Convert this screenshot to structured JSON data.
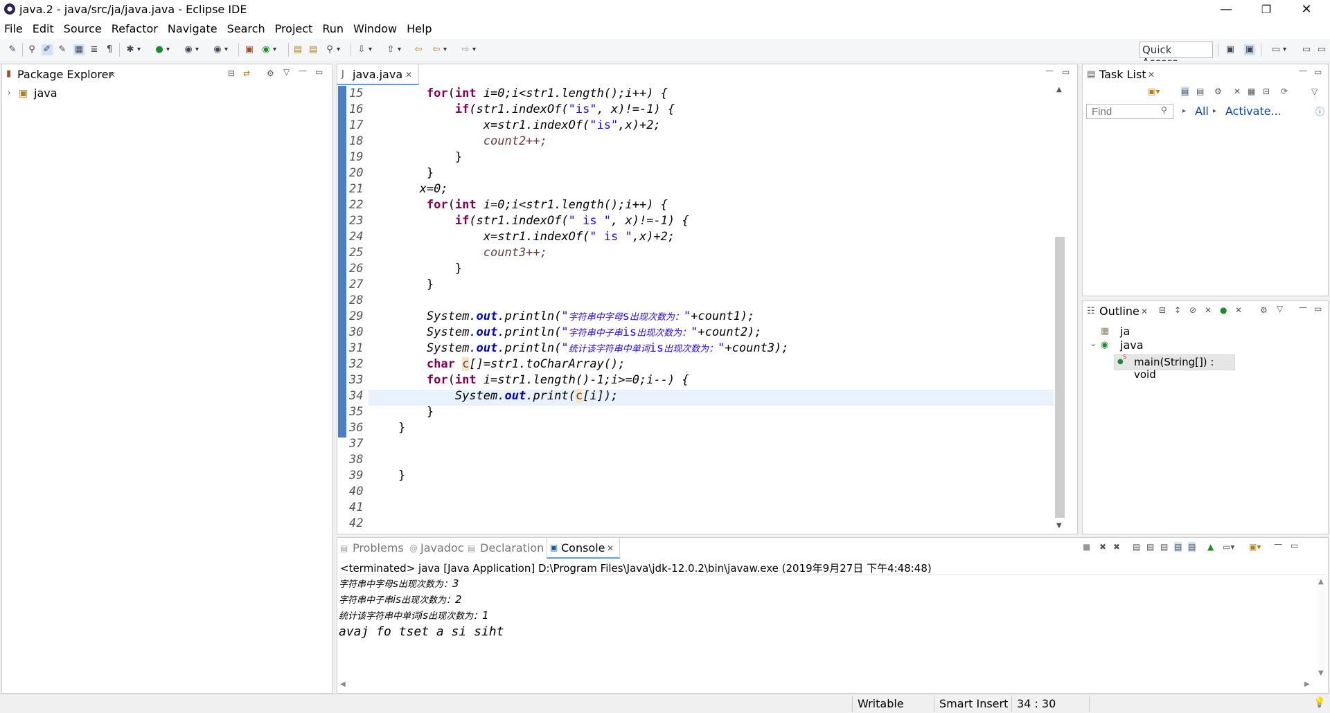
{
  "window": {
    "title": "java.2 - java/src/ja/java.java - Eclipse IDE",
    "minimize": "—",
    "restore": "❐",
    "close": "✕"
  },
  "menu": [
    "File",
    "Edit",
    "Source",
    "Refactor",
    "Navigate",
    "Search",
    "Project",
    "Run",
    "Window",
    "Help"
  ],
  "toolbar": {
    "quick_access": "Quick Access"
  },
  "package_explorer": {
    "title": "Package Explorer",
    "tree": [
      {
        "label": "java",
        "expanded": false
      }
    ]
  },
  "editor": {
    "tab_title": "java.java",
    "line_numbers": [
      "15",
      "16",
      "17",
      "18",
      "19",
      "20",
      "21",
      "22",
      "23",
      "24",
      "25",
      "26",
      "27",
      "28",
      "29",
      "30",
      "31",
      "32",
      "33",
      "34",
      "35",
      "36",
      "37",
      "38",
      "39",
      "40",
      "41",
      "42"
    ],
    "code": {
      "l15": {
        "kw_for": "for",
        "open": "(",
        "kw_int": "int",
        "rest": " i=0;i<str1.length();i++) {"
      },
      "l16": {
        "kw_if": "if",
        "a": "(str1.indexOf(",
        "s": "\"is\"",
        "b": ", x)!=-1) {"
      },
      "l17": {
        "a": "x=str1.indexOf(",
        "s": "\"is\"",
        "b": ",x)+2;"
      },
      "l18": "count2++;",
      "l19": "}",
      "l20": "}",
      "l21": "x=0;",
      "l22": {
        "kw_for": "for",
        "open": "(",
        "kw_int": "int",
        "rest": " i=0;i<str1.length();i++) {"
      },
      "l23": {
        "kw_if": "if",
        "a": "(str1.indexOf(",
        "s": "\" is \"",
        "b": ", x)!=-1) {"
      },
      "l24": {
        "a": "x=str1.indexOf(",
        "s": "\" is \"",
        "b": ",x)+2;"
      },
      "l25": "count3++;",
      "l26": "}",
      "l27": "}",
      "l29": {
        "a": "System.",
        "out": "out",
        "b": ".println(",
        "q": "\"",
        "cn": "字符串中字母",
        "s2": "s",
        "cn2": "出现次数为：",
        "e": "\"",
        "tail": "+count1);"
      },
      "l30": {
        "a": "System.",
        "out": "out",
        "b": ".println(",
        "q": "\"",
        "cn": "字符串中子串",
        "s2": "is",
        "cn2": "出现次数为：",
        "e": "\"",
        "tail": "+count2);"
      },
      "l31": {
        "a": "System.",
        "out": "out",
        "b": ".println(",
        "q": "\"",
        "cn": "统计该字符串中单词",
        "s2": "is",
        "cn2": "出现次数为：",
        "e": "\"",
        "tail": "+count3);"
      },
      "l32": {
        "kw": "char",
        "sp": " ",
        "c": "c",
        "rest": "[]=str1.toCharArray();"
      },
      "l33": {
        "kw_for": "for",
        "open": "(",
        "kw_int": "int",
        "rest": " i=str1.length()-1;i>=0;i--) {"
      },
      "l34": {
        "a": "System.",
        "out": "out",
        "b": ".print(",
        "c": "c",
        "rest": "[i]);"
      },
      "l35": "}",
      "l36": "}",
      "l39": "}"
    }
  },
  "task_list": {
    "title": "Task List",
    "find_placeholder": "Find",
    "all": "All",
    "activate": "Activate..."
  },
  "outline": {
    "title": "Outline",
    "items": [
      {
        "label": "ja",
        "kind": "package"
      },
      {
        "label": "java",
        "kind": "class",
        "expanded": true
      },
      {
        "label": "main(String[]) : void",
        "kind": "method",
        "selected": true
      }
    ]
  },
  "bottom_tabs": {
    "problems": "Problems",
    "javadoc": "Javadoc",
    "declaration": "Declaration",
    "console": "Console"
  },
  "console": {
    "header": "<terminated> java [Java Application] D:\\Program Files\\Java\\jdk-12.0.2\\bin\\javaw.exe (2019年9月27日 下午4:48:48)",
    "lines": [
      {
        "cn": "字符串中字母",
        "s": "s",
        "cn2": "出现次数为：",
        "n": "3"
      },
      {
        "cn": "字符串中子串",
        "s": "is",
        "cn2": "出现次数为：",
        "n": "2"
      },
      {
        "cn": "统计该字符串中单词",
        "s": "is",
        "cn2": "出现次数为：",
        "n": "1"
      }
    ],
    "reversed": "avaj fo tset a si siht"
  },
  "statusbar": {
    "writable": "Writable",
    "insert_mode": "Smart Insert",
    "position": "34 : 30"
  }
}
